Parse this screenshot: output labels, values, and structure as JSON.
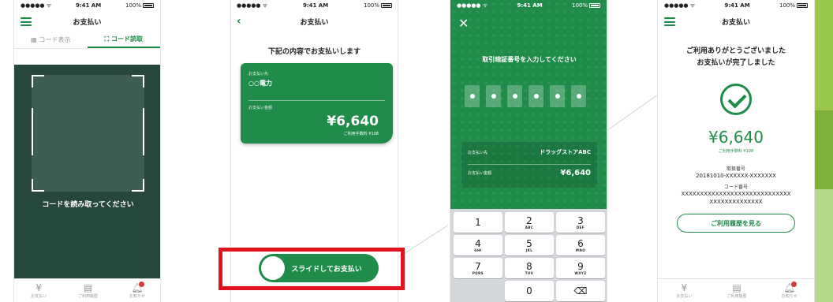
{
  "status": {
    "carrier": "●●●●● ᯤ",
    "time": "9:41 AM",
    "battery": "100%"
  },
  "phone1": {
    "title": "お支払い",
    "seg_display": "コード表示",
    "seg_scan": "コード読取",
    "scan_message": "コードを読み取ってください"
  },
  "tabs": [
    {
      "label": "お支払い",
      "icon": "yen-icon"
    },
    {
      "label": "ご利用履歴",
      "icon": "receipt-icon"
    },
    {
      "label": "お知らせ",
      "icon": "bell-icon"
    }
  ],
  "phone2": {
    "title": "お支払い",
    "intro": "下記の内容でお支払いします",
    "payee_label": "お支払い先",
    "payee": "○○電力",
    "amount_label": "お支払い金額",
    "amount": "¥6,640",
    "fee": "ご利用手数料 ¥108",
    "slide_label": "スライドしてお支払い"
  },
  "phone3": {
    "prompt": "取引暗証番号を入力してください",
    "pins": 6,
    "payee_label": "お支払い先",
    "payee": "ドラッグストアABC",
    "amount_label": "お支払い金額",
    "amount": "¥6,640",
    "keys": [
      {
        "d": "1",
        "l": ""
      },
      {
        "d": "2",
        "l": "ABC"
      },
      {
        "d": "3",
        "l": "DEF"
      },
      {
        "d": "4",
        "l": "GHI"
      },
      {
        "d": "5",
        "l": "JKL"
      },
      {
        "d": "6",
        "l": "MNO"
      },
      {
        "d": "7",
        "l": "PQRS"
      },
      {
        "d": "8",
        "l": "TUV"
      },
      {
        "d": "9",
        "l": "WXYZ"
      },
      {
        "d": "",
        "l": ""
      },
      {
        "d": "0",
        "l": ""
      },
      {
        "d": "⌫",
        "l": ""
      }
    ]
  },
  "phone4": {
    "title": "お支払い",
    "thanks_line1": "ご利用ありがとうございました",
    "thanks_line2": "お支払いが完了しました",
    "amount": "¥6,640",
    "fee": "ご利用手数料 ¥108",
    "txn_label": "取扱番号",
    "txn_no": "20181010-XXXXXX-XXXXXXX",
    "code_label": "コード番号",
    "code_line1": "XXXXXXXXXXXXXXXXXXXXXXXXXXXXX",
    "code_line2": "XXXXXXXXXXXXXX",
    "history_button": "ご利用履歴を見る"
  },
  "colors": {
    "brand_green": "#1f8c4a",
    "highlight_red": "#e0141e"
  }
}
